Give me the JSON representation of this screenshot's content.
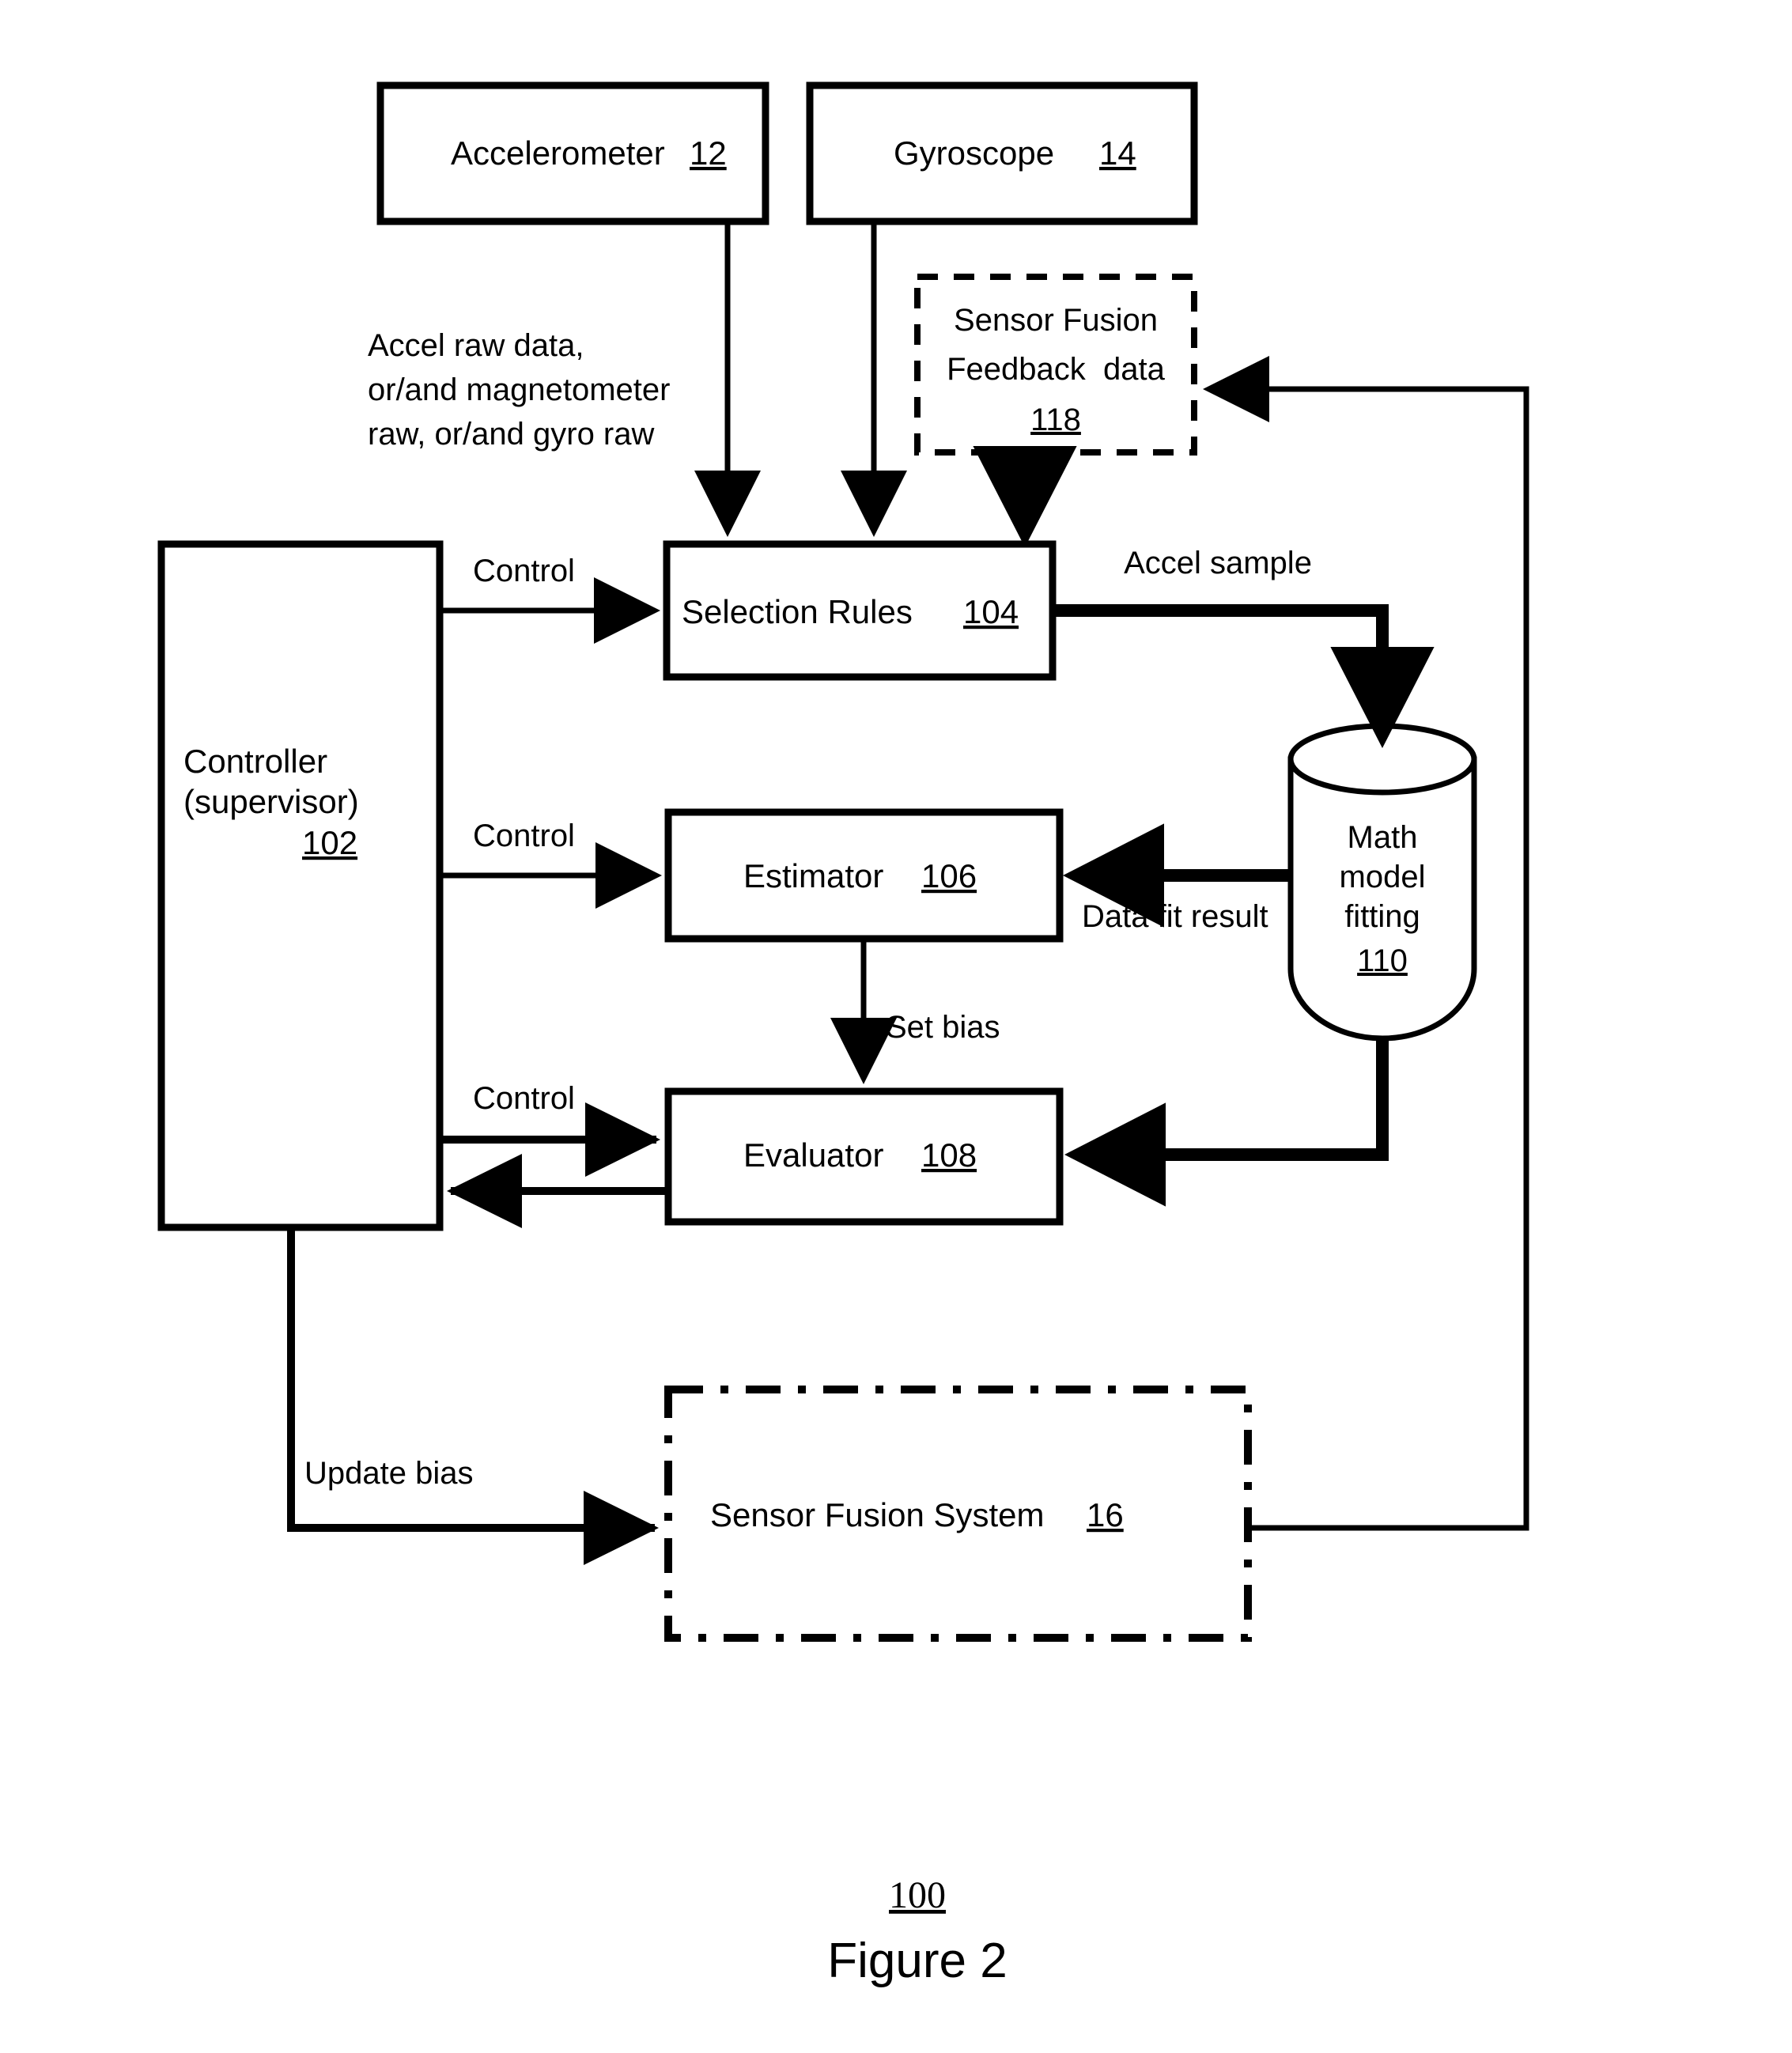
{
  "figure": {
    "number_label": "100",
    "caption": "Figure 2"
  },
  "blocks": {
    "accelerometer": {
      "label": "Accelerometer",
      "ref": "12"
    },
    "gyroscope": {
      "label": "Gyroscope",
      "ref": "14"
    },
    "feedback_data": {
      "line1": "Sensor Fusion",
      "line2": "Feedback  data",
      "ref": "118"
    },
    "selection_rules": {
      "label": "Selection Rules",
      "ref": "104"
    },
    "controller": {
      "line1": "Controller",
      "line2": "(supervisor)",
      "ref": "102"
    },
    "estimator": {
      "label": "Estimator",
      "ref": "106"
    },
    "evaluator": {
      "label": "Evaluator",
      "ref": "108"
    },
    "math_model": {
      "line1": "Math",
      "line2": "model",
      "line3": "fitting",
      "ref": "110"
    },
    "sensor_fusion_system": {
      "label": "Sensor Fusion System",
      "ref": "16"
    }
  },
  "edge_labels": {
    "raw_data_line1": "Accel raw data,",
    "raw_data_line2": "or/and magnetometer",
    "raw_data_line3": "raw, or/and gyro raw",
    "control_selection": "Control",
    "control_estimator": "Control",
    "control_evaluator": "Control",
    "accel_sample": "Accel sample",
    "data_fit_result": "Data fit result",
    "set_bias": "Set bias",
    "update_bias": "Update bias"
  },
  "colors": {
    "ink": "#000000",
    "paper": "#ffffff"
  }
}
